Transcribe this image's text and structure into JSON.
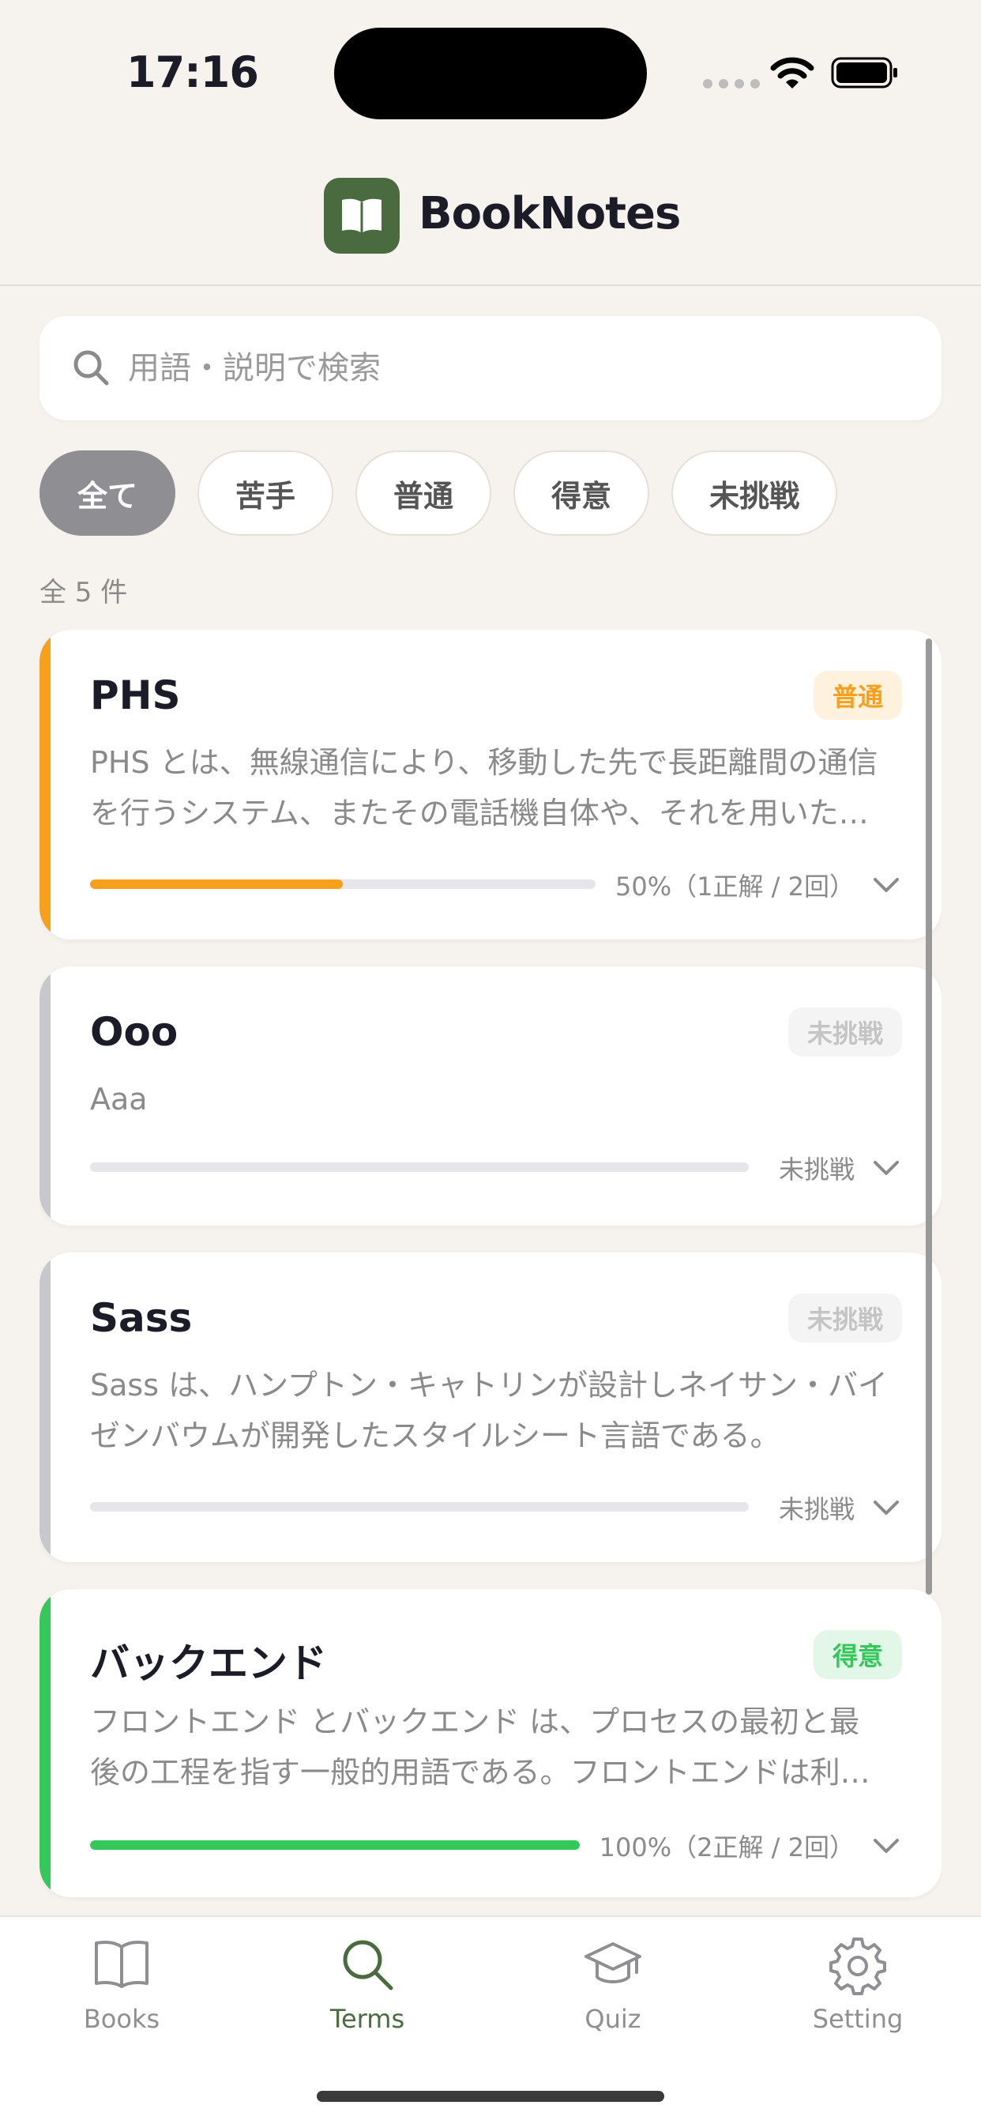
{
  "status": {
    "time": "17:16"
  },
  "header": {
    "title": "BookNotes"
  },
  "search": {
    "placeholder": "用語・説明で検索",
    "value": ""
  },
  "filters": [
    {
      "label": "全て",
      "active": true
    },
    {
      "label": "苦手",
      "active": false
    },
    {
      "label": "普通",
      "active": false
    },
    {
      "label": "得意",
      "active": false
    },
    {
      "label": "未挑戦",
      "active": false
    }
  ],
  "count_label": "全 5 件",
  "terms": [
    {
      "title": "PHS",
      "badge": "普通",
      "description": "PHS とは、無線通信により、移動した先で長距離間の通信を行うシステム、またその電話機自体や、それを用いたサービスのことである。",
      "progress": 0.5,
      "progress_label": "50%（1正解 / 2回）",
      "accent_color": "#f7a01c",
      "badge_color": "#f7a01c",
      "badge_bg": "#fef1de"
    },
    {
      "title": "Ooo",
      "badge": "未挑戦",
      "description": "Aaa",
      "progress": 0,
      "progress_label": "未挑戦",
      "accent_color": "#c7c7cc",
      "badge_color": "#c4c4c4",
      "badge_bg": "#f4f4f4"
    },
    {
      "title": "Sass",
      "badge": "未挑戦",
      "description": "Sass は、ハンプトン・キャトリンが設計しネイサン・バイゼンバウムが開発したスタイルシート言語である。",
      "progress": 0,
      "progress_label": "未挑戦",
      "accent_color": "#c7c7cc",
      "badge_color": "#c4c4c4",
      "badge_bg": "#f4f4f4"
    },
    {
      "title": "バックエンド",
      "badge": "得意",
      "description": "フロントエンド とバックエンド は、プロセスの最初と最後の工程を指す一般的用語である。フロントエンドは利用者と直接やりとりする部分である。",
      "progress": 1.0,
      "progress_label": "100%（2正解 / 2回）",
      "accent_color": "#34c759",
      "badge_color": "#34c759",
      "badge_bg": "#e3f7e8"
    }
  ],
  "tabs": [
    {
      "label": "Books",
      "icon": "book-open-icon",
      "active": false
    },
    {
      "label": "Terms",
      "icon": "search-icon",
      "active": true
    },
    {
      "label": "Quiz",
      "icon": "graduation-cap-icon",
      "active": false
    },
    {
      "label": "Setting",
      "icon": "gear-icon",
      "active": false
    }
  ],
  "colors": {
    "accent": "#4a6a3f",
    "background": "#f6f3ee"
  }
}
